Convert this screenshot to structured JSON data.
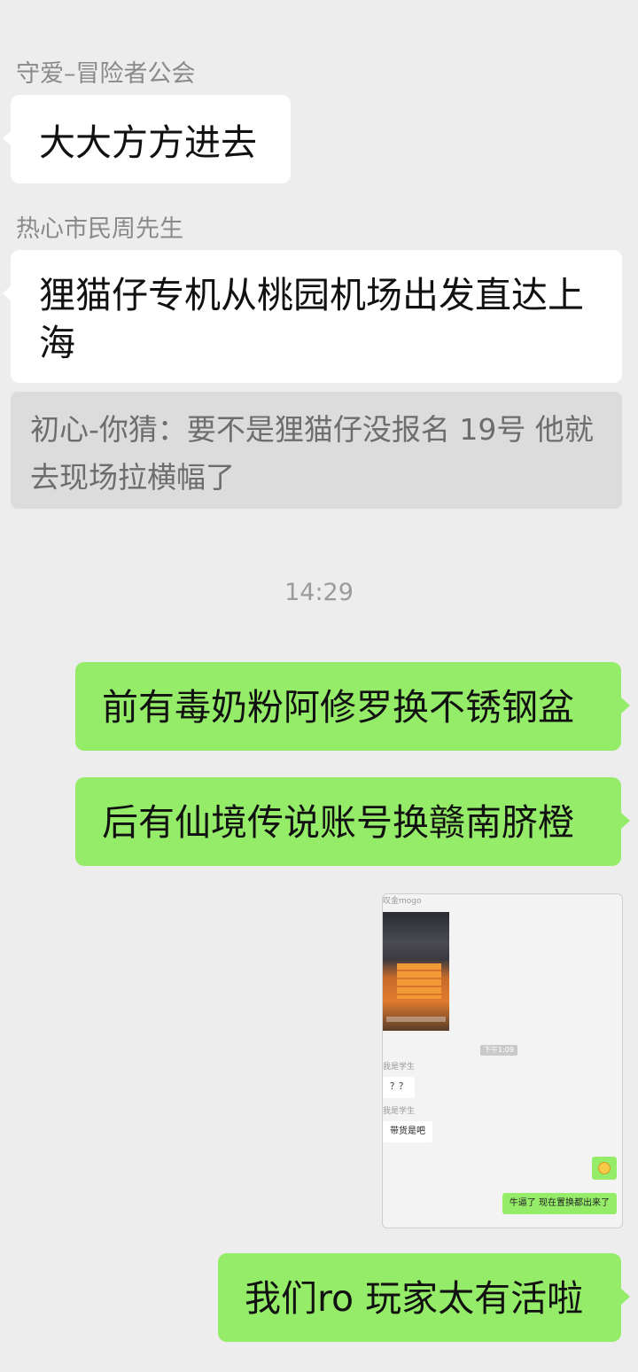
{
  "messages": {
    "m1": {
      "sender": "守爱–冒险者公会",
      "text": "大大方方进去"
    },
    "m2": {
      "sender": "热心市民周先生",
      "text": "狸猫仔专机从桃园机场出发直达上海"
    },
    "quote": {
      "text": "初心-你猜：要不是狸猫仔没报名 19号 他就去现场拉横幅了"
    },
    "timestamp": "14:29",
    "out1": "前有毒奶粉阿修罗换不锈钢盆",
    "out2": "后有仙境传说账号换赣南脐橙",
    "out3": "我们ro 玩家太有活啦"
  },
  "screenshot": {
    "top_name": "叹金mogo",
    "time": "下午1:09",
    "sender": "我是学生",
    "msg1": "？？",
    "msg2": "带货是吧",
    "reply": "牛逼了 现在置换都出来了",
    "emoji": "smiling-face"
  }
}
